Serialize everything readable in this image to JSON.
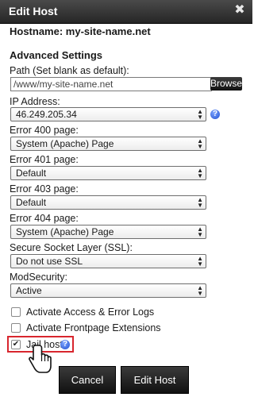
{
  "dialog": {
    "title": "Edit Host",
    "close_glyph": "✖"
  },
  "hostname": "Hostname: my-site-name.net",
  "section_title": "Advanced Settings",
  "path": {
    "label": "Path (Set blank as default):",
    "value": "/www/my-site-name.net",
    "browse_label": "Browse"
  },
  "ip": {
    "label": "IP Address:",
    "value": "46.249.205.34",
    "help": "?"
  },
  "error400": {
    "label": "Error 400 page:",
    "value": "System (Apache) Page"
  },
  "error401": {
    "label": "Error 401 page:",
    "value": "Default"
  },
  "error403": {
    "label": "Error 403 page:",
    "value": "Default"
  },
  "error404": {
    "label": "Error 404 page:",
    "value": "System (Apache) Page"
  },
  "ssl": {
    "label": "Secure Socket Layer (SSL):",
    "value": "Do not use SSL"
  },
  "modsec": {
    "label": "ModSecurity:",
    "value": "Active"
  },
  "checks": {
    "logs": {
      "label": "Activate Access & Error Logs",
      "checked": false
    },
    "frontpage": {
      "label": "Activate Frontpage Extensions",
      "checked": false
    },
    "jail": {
      "label": "Jail host",
      "checked": true,
      "check_glyph": "✔",
      "help": "?"
    }
  },
  "buttons": {
    "cancel": "Cancel",
    "submit": "Edit Host"
  },
  "colors": {
    "highlight": "#d8262e",
    "help": "#1f4fd1"
  }
}
